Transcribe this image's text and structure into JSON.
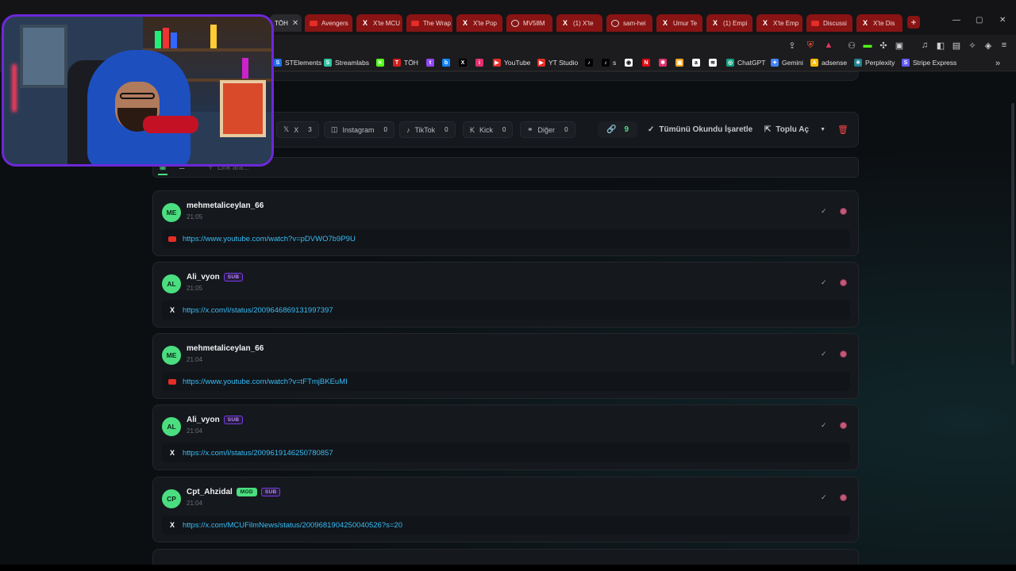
{
  "browser": {
    "tabs": [
      {
        "label": "TÖH",
        "icon": "none",
        "active": true
      },
      {
        "label": "Avengers",
        "icon": "youtube-icon"
      },
      {
        "label": "X'te MCU",
        "icon": "x-icon"
      },
      {
        "label": "The Wrap",
        "icon": "youtube-icon"
      },
      {
        "label": "X'te Pop",
        "icon": "x-icon"
      },
      {
        "label": "MV58M",
        "icon": "globe-icon"
      },
      {
        "label": "(1) X'te",
        "icon": "x-icon"
      },
      {
        "label": "sam-hei",
        "icon": "globe-icon"
      },
      {
        "label": "Umur Te",
        "icon": "x-icon"
      },
      {
        "label": "(1) Empi",
        "icon": "x-icon"
      },
      {
        "label": "X'te Emp",
        "icon": "x-icon"
      },
      {
        "label": "Discussi",
        "icon": "youtube-icon"
      },
      {
        "label": "X'te Dis",
        "icon": "x-icon"
      }
    ],
    "new_tab": "+",
    "bookmarks": [
      {
        "label": "STElements",
        "color": "#1f6feb",
        "glyph": "S"
      },
      {
        "label": "Streamlabs",
        "color": "#31c3a2",
        "glyph": "S"
      },
      {
        "label": "",
        "color": "#53fc18",
        "glyph": "K"
      },
      {
        "label": "TÖH",
        "color": "#d21f1f",
        "glyph": "T"
      },
      {
        "label": "",
        "color": "#9146ff",
        "glyph": "t"
      },
      {
        "label": "",
        "color": "#1185fe",
        "glyph": "b"
      },
      {
        "label": "",
        "color": "#000000",
        "glyph": "X"
      },
      {
        "label": "",
        "color": "#e1306c",
        "glyph": "i"
      },
      {
        "label": "YouTube",
        "color": "#e52d27",
        "glyph": "▶"
      },
      {
        "label": "YT Studio",
        "color": "#e52d27",
        "glyph": "▶"
      },
      {
        "label": "",
        "color": "#000000",
        "glyph": "♪"
      },
      {
        "label": "s",
        "color": "#000000",
        "glyph": "♪"
      },
      {
        "label": "",
        "color": "#ffffff",
        "glyph": "◉"
      },
      {
        "label": "",
        "color": "#e50914",
        "glyph": "N"
      },
      {
        "label": "",
        "color": "#e1306c",
        "glyph": "✱"
      },
      {
        "label": "",
        "color": "#f5a623",
        "glyph": "▣"
      },
      {
        "label": "",
        "color": "#ffffff",
        "glyph": "a"
      },
      {
        "label": "",
        "color": "#ffffff",
        "glyph": "≋"
      },
      {
        "label": "ChatGPT",
        "color": "#10a37f",
        "glyph": "◎"
      },
      {
        "label": "Gemini",
        "color": "#4285f4",
        "glyph": "✦"
      },
      {
        "label": "adsense",
        "color": "#fbbc04",
        "glyph": "A"
      },
      {
        "label": "Perplexity",
        "color": "#20808d",
        "glyph": "✳"
      },
      {
        "label": "Stripe Express",
        "color": "#635bff",
        "glyph": "S"
      }
    ]
  },
  "filters": {
    "chips": [
      {
        "label": "X",
        "count": "3",
        "icon": "x-icon"
      },
      {
        "label": "Instagram",
        "count": "0",
        "icon": "instagram-icon"
      },
      {
        "label": "TikTok",
        "count": "0",
        "icon": "tiktok-icon"
      },
      {
        "label": "Kick",
        "count": "0",
        "icon": "kick-icon"
      },
      {
        "label": "Diğer",
        "count": "0",
        "icon": "link-icon"
      }
    ],
    "total_links": "9",
    "mark_all_read": "Tümünü Okundu İşaretle",
    "bulk_open": "Toplu Aç",
    "accent": "#4ade80"
  },
  "search": {
    "placeholder": "Link ara..."
  },
  "messages": [
    {
      "initials": "ME",
      "user": "mehmetaliceylan_66",
      "time": "21:05",
      "badges": [],
      "platform": "youtube",
      "url": "https://www.youtube.com/watch?v=pDVWO7b9P9U"
    },
    {
      "initials": "AL",
      "user": "Ali_vyon",
      "time": "21:05",
      "badges": [
        "SUB"
      ],
      "platform": "x",
      "url": "https://x.com/i/status/2009646869131997397"
    },
    {
      "initials": "ME",
      "user": "mehmetaliceylan_66",
      "time": "21:04",
      "badges": [],
      "platform": "youtube",
      "url": "https://www.youtube.com/watch?v=tFTmjBKEuMI"
    },
    {
      "initials": "AL",
      "user": "Ali_vyon",
      "time": "21:04",
      "badges": [
        "SUB"
      ],
      "platform": "x",
      "url": "https://x.com/i/status/2009619146250780857"
    },
    {
      "initials": "CP",
      "user": "Cpt_Ahzidal",
      "time": "21:04",
      "badges": [
        "MOD",
        "SUB"
      ],
      "platform": "x",
      "url": "https://x.com/MCUFilmNews/status/2009681904250040526?s=20"
    }
  ]
}
